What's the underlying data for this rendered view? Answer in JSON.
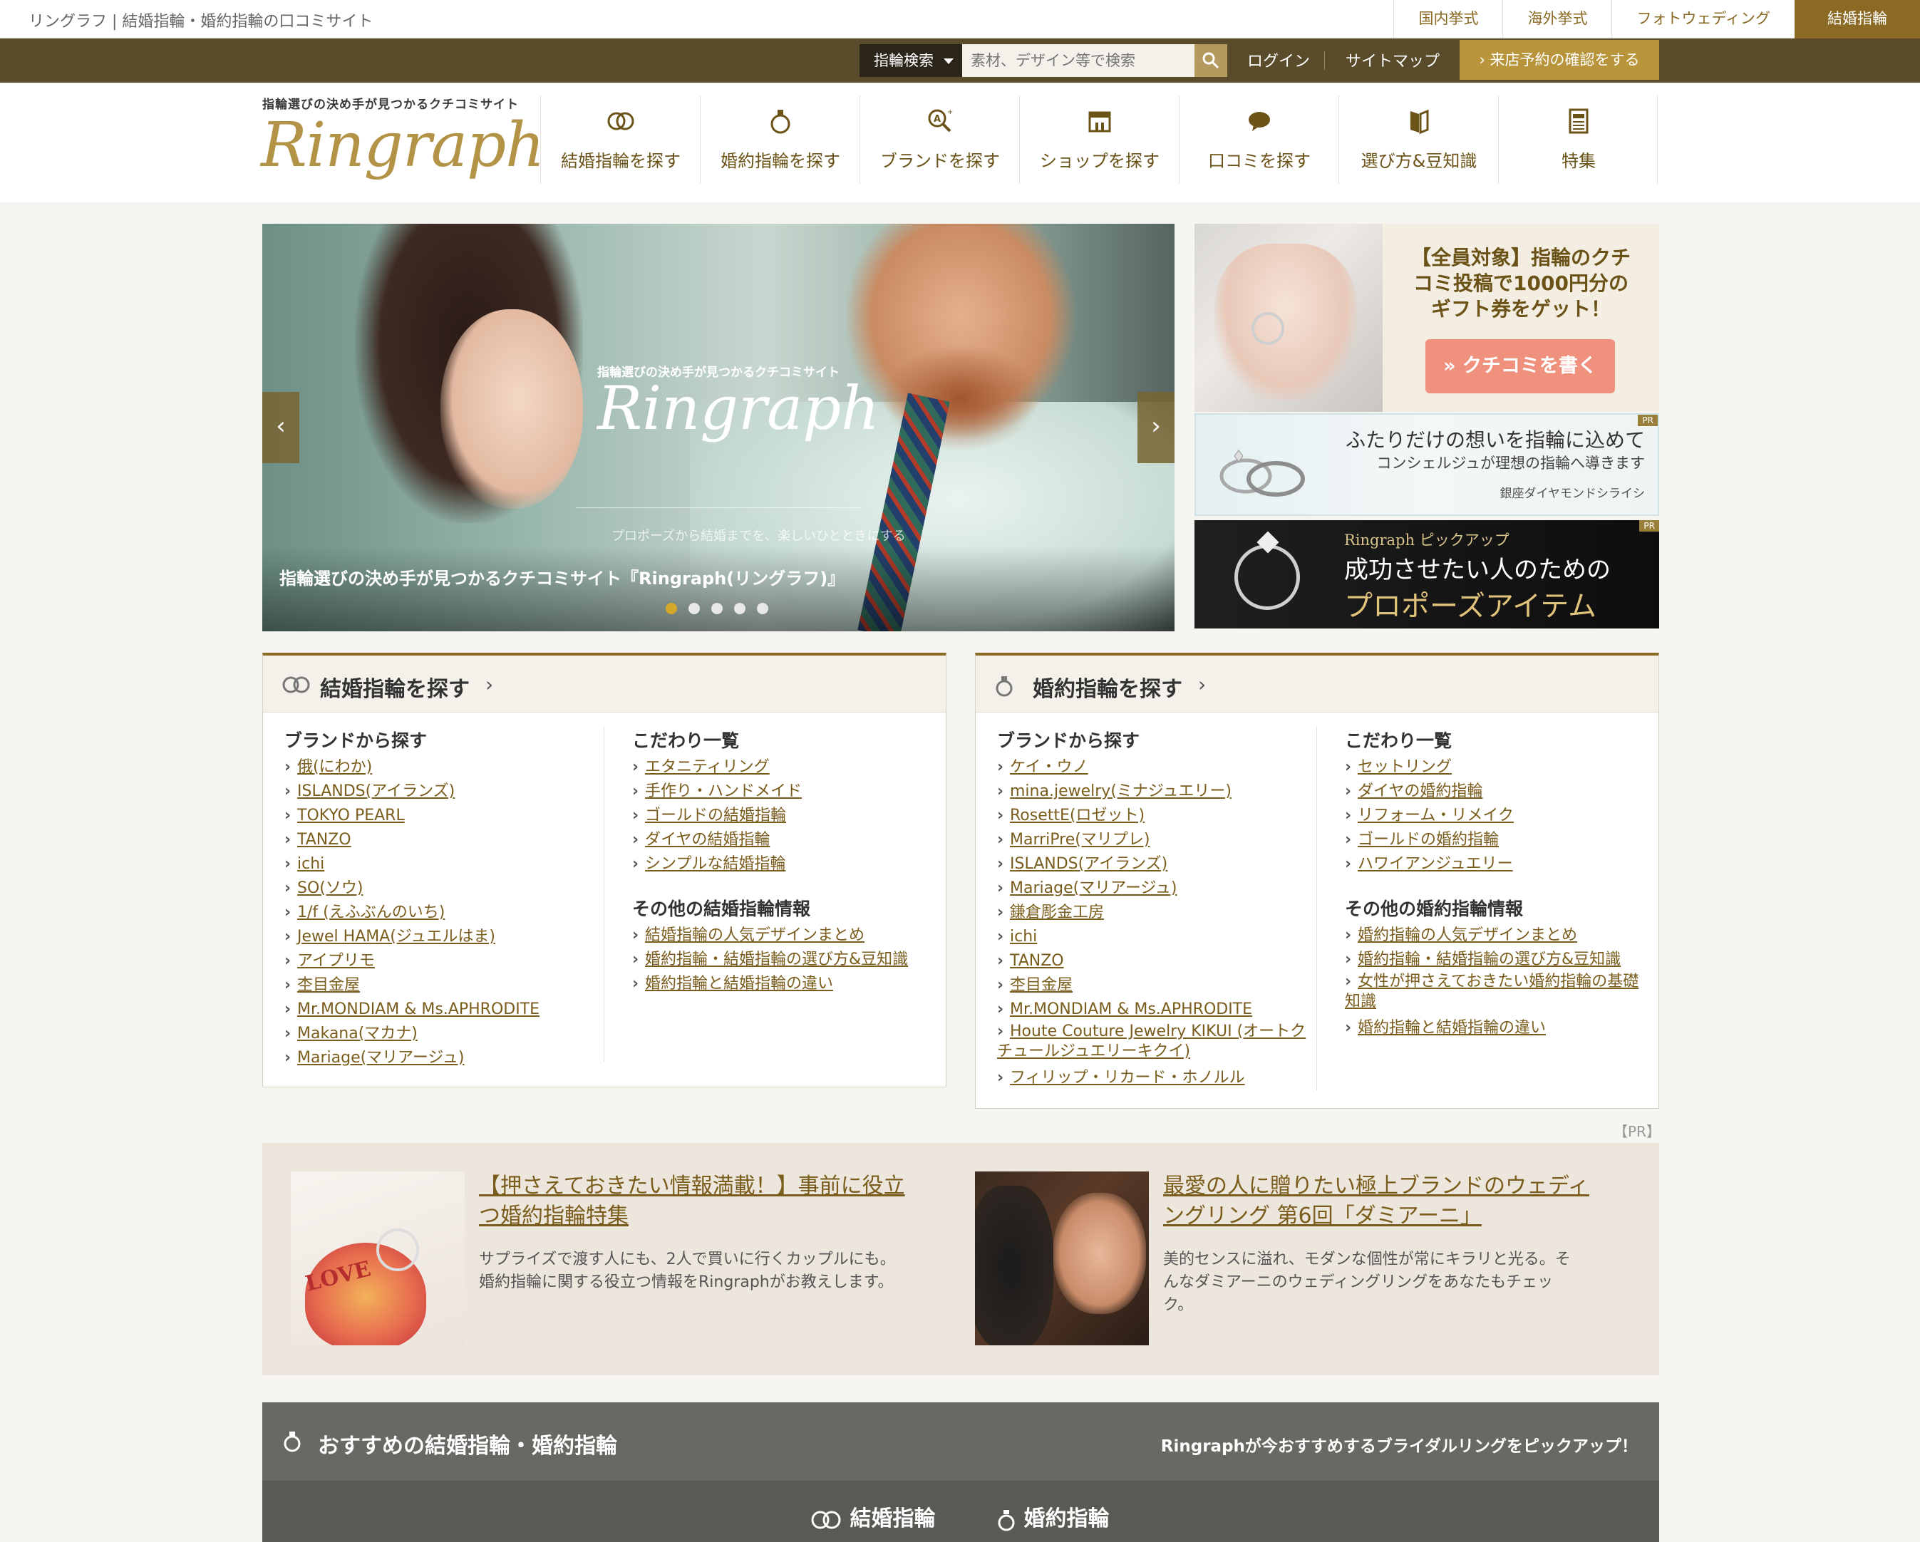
{
  "topbar": {
    "site_title": "リングラフ | 結婚指輪・婚約指輪の口コミサイト",
    "links": [
      "国内挙式",
      "海外挙式",
      "フォトウェディング",
      "結婚指輪"
    ]
  },
  "utilbar": {
    "search_select": "指輪検索",
    "search_placeholder": "素材、デザイン等で検索",
    "login": "ログイン",
    "sitemap": "サイトマップ",
    "reserve": "› 来店予約の確認をする"
  },
  "header": {
    "logo_tagline": "指輪選びの決め手が見つかるクチコミサイト",
    "logo_text": "Ringraph",
    "nav": [
      {
        "label": "結婚指輪を探す",
        "icon": "wedding-rings-icon"
      },
      {
        "label": "婚約指輪を探す",
        "icon": "engagement-ring-icon"
      },
      {
        "label": "ブランドを探す",
        "icon": "brand-search-icon"
      },
      {
        "label": "ショップを探す",
        "icon": "shop-icon"
      },
      {
        "label": "口コミを探す",
        "icon": "speech-bubble-icon"
      },
      {
        "label": "選び方&豆知識",
        "icon": "book-icon"
      },
      {
        "label": "特集",
        "icon": "article-icon"
      }
    ]
  },
  "hero": {
    "logo_tagline": "指輪選びの決め手が見つかるクチコミサイト",
    "logo_text": "Ringraph",
    "subcopy": "プロポーズから結婚までを、楽しいひとときにする",
    "caption": "指輪選びの決め手が見つかるクチコミサイト『Ringraph(リングラフ)』",
    "prev": "‹",
    "next": "›",
    "slide_count": 5,
    "active_slide": 1
  },
  "banners": {
    "review": {
      "title": "【全員対象】指輪のクチコミ投稿で1000円分のギフト券をゲット！",
      "title_lines": [
        "【全員対象】指輪のクチ",
        "コミ投稿で1000円分の",
        "ギフト券をゲット！"
      ],
      "button": "» クチコミを書く"
    },
    "ginza": {
      "main": "ふたりだけの想いを指輪に込めて",
      "sub": "コンシェルジュが理想の指輪へ導きます",
      "brand": "銀座ダイヤモンドシライシ",
      "pr": "PR"
    },
    "propose": {
      "tag": "Ringraph ピックアップ",
      "line1": "成功させたい人のための",
      "line2": "プロポーズアイテム",
      "pr": "PR"
    }
  },
  "wedding_box": {
    "title": "結婚指輪を探す",
    "chevron": "›",
    "brand_title": "ブランドから探す",
    "brands": [
      "俄(にわか)",
      "ISLANDS(アイランズ)",
      "TOKYO PEARL",
      "TANZO",
      "ichi",
      "SO(ソウ)",
      "1/f (えふぶんのいち)",
      "Jewel HAMA(ジュエルはま)",
      "アイプリモ",
      "杢目金屋",
      "Mr.MONDIAM & Ms.APHRODITE",
      "Makana(マカナ)",
      "Mariage(マリアージュ)"
    ],
    "kodawari_title": "こだわり一覧",
    "kodawari": [
      "エタニティリング",
      "手作り・ハンドメイド",
      "ゴールドの結婚指輪",
      "ダイヤの結婚指輪",
      "シンプルな結婚指輪"
    ],
    "other_title": "その他の結婚指輪情報",
    "other": [
      "結婚指輪の人気デザインまとめ",
      "婚約指輪・結婚指輪の選び方&豆知識",
      "婚約指輪と結婚指輪の違い"
    ]
  },
  "engagement_box": {
    "title": "婚約指輪を探す",
    "chevron": "›",
    "brand_title": "ブランドから探す",
    "brands": [
      "ケイ・ウノ",
      "mina.jewelry(ミナジュエリー)",
      "RosettE(ロゼット)",
      "MarriPre(マリプレ)",
      "ISLANDS(アイランズ)",
      "Mariage(マリアージュ)",
      "鎌倉彫金工房",
      "ichi",
      "TANZO",
      "杢目金屋",
      "Mr.MONDIAM & Ms.APHRODITE",
      "Houte Couture Jewelry KIKUI (オートクチュールジュエリーキクイ)",
      "フィリップ・リカード・ホノルル"
    ],
    "kodawari_title": "こだわり一覧",
    "kodawari": [
      "セットリング",
      "ダイヤの婚約指輪",
      "リフォーム・リメイク",
      "ゴールドの婚約指輪",
      "ハワイアンジュエリー"
    ],
    "other_title": "その他の婚約指輪情報",
    "other": [
      "婚約指輪の人気デザインまとめ",
      "婚約指輪・結婚指輪の選び方&豆知識",
      "女性が押さえておきたい婚約指輪の基礎知識",
      "婚約指輪と結婚指輪の違い"
    ]
  },
  "pr_label": "【PR】",
  "features": [
    {
      "title": "【押さえておきたい情報満載！】事前に役立つ婚約指輪特集",
      "title_lines": [
        "【押さえておきたい情報満載！】事前に役立",
        "つ婚約指輪特集"
      ],
      "desc_lines": [
        "サプライズで渡す人にも、2人で買いに行くカップルにも。",
        "婚約指輪に関する役立つ情報をRingraphがお教えします。"
      ],
      "image_text": "LOVE"
    },
    {
      "title": "最愛の人に贈りたい極上ブランドのウェディングリング 第6回「ダミアーニ」",
      "title_lines": [
        "最愛の人に贈りたい極上ブランドのウェディ",
        "ングリング 第6回「ダミアーニ」"
      ],
      "desc_lines": [
        "美的センスに溢れ、モダンな個性が常にキラリと光る。そ",
        "んなダミアーニのウェディングリングをあなたもチェッ",
        "ク。"
      ]
    }
  ],
  "recommend": {
    "title": "おすすめの結婚指輪・婚約指輪",
    "subtitle": "Ringraphが今おすすめするブライダルリングをピックアップ！",
    "tabs": [
      "結婚指輪",
      "婚約指輪"
    ]
  },
  "colors": {
    "brand_gold": "#b39345",
    "dark_bar": "#5a4b2a",
    "link": "#7a5d1c",
    "cta_pink": "#f0917e"
  }
}
